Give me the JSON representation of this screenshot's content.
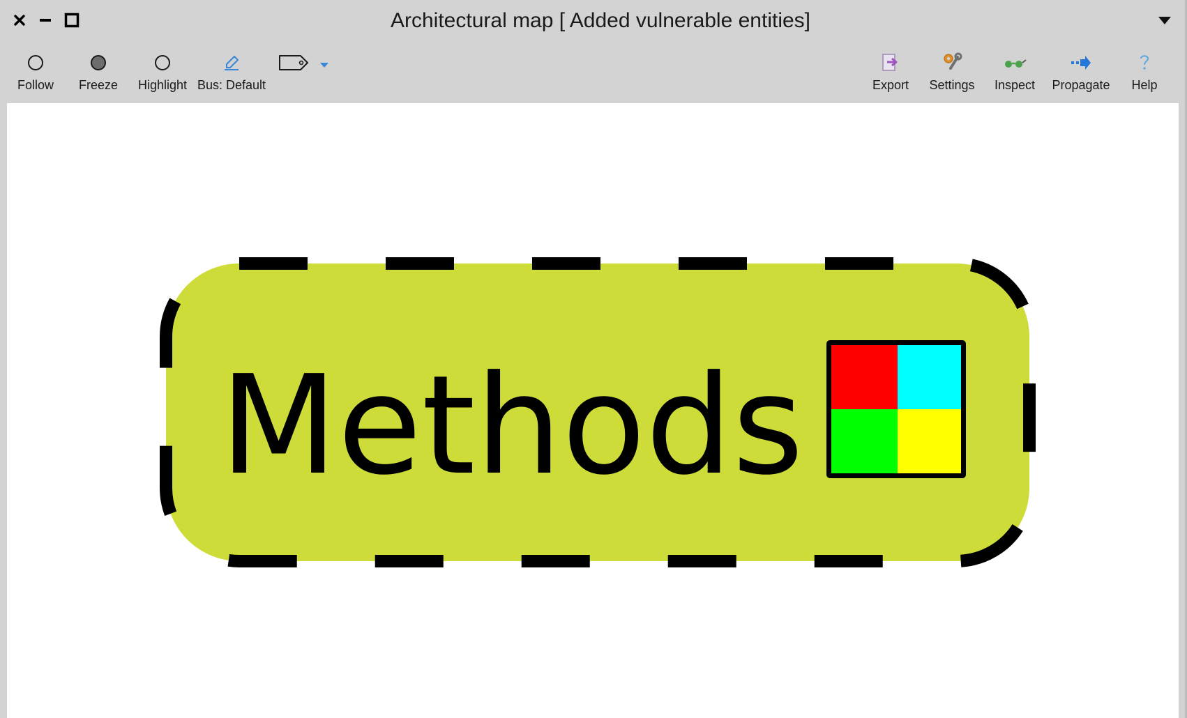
{
  "window": {
    "title": "Architectural map [ Added vulnerable entities]",
    "controls": {
      "close": "close-icon",
      "minimize": "minimize-icon",
      "maximize": "maximize-icon"
    },
    "menu_icon": "triangle-down-icon"
  },
  "toolbar": {
    "left": [
      {
        "id": "follow",
        "label": "Follow",
        "icon": "empty-circle-icon"
      },
      {
        "id": "freeze",
        "label": "Freeze",
        "icon": "filled-circle-icon"
      },
      {
        "id": "highlight",
        "label": "Highlight",
        "icon": "empty-circle-icon"
      },
      {
        "id": "bus",
        "label": "Bus: Default",
        "icon": "pencil-icon"
      },
      {
        "id": "tag",
        "label": "",
        "icon": "tag-icon"
      }
    ],
    "dropdown_icon": "chevron-down-icon",
    "right": [
      {
        "id": "export",
        "label": "Export",
        "icon": "export-icon"
      },
      {
        "id": "settings",
        "label": "Settings",
        "icon": "wrench-icon"
      },
      {
        "id": "inspect",
        "label": "Inspect",
        "icon": "glasses-icon"
      },
      {
        "id": "propagate",
        "label": "Propagate",
        "icon": "arrow-right-icon"
      },
      {
        "id": "help",
        "label": "Help",
        "icon": "question-icon"
      }
    ]
  },
  "map": {
    "node": {
      "label": "Methods",
      "fill": "#cddc39",
      "border": "dashed"
    },
    "legend_colors": [
      "#ff0000",
      "#00ffff",
      "#00ff00",
      "#ffff00"
    ]
  }
}
